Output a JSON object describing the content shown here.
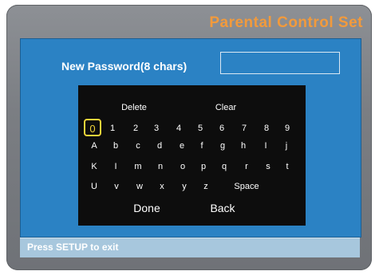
{
  "title": "Parental Control Set",
  "password": {
    "label": "New Password(8 chars)",
    "value": ""
  },
  "keyboard": {
    "delete": "Delete",
    "clear": "Clear",
    "row1": [
      "0",
      "1",
      "2",
      "3",
      "4",
      "5",
      "6",
      "7",
      "8",
      "9"
    ],
    "row2": [
      "A",
      "b",
      "c",
      "d",
      "e",
      "f",
      "g",
      "h",
      "I",
      "j"
    ],
    "row3": [
      "K",
      "I",
      "m",
      "n",
      "o",
      "p",
      "q",
      "r",
      "s",
      "t"
    ],
    "row4": [
      "U",
      "v",
      "w",
      "x",
      "y",
      "z"
    ],
    "space": "Space",
    "done": "Done",
    "back": "Back",
    "selected": "0"
  },
  "footer": "Press SETUP to exit",
  "colors": {
    "panel": "#2b82c4",
    "title": "#f29a3c",
    "highlight": "#f2d43a"
  }
}
